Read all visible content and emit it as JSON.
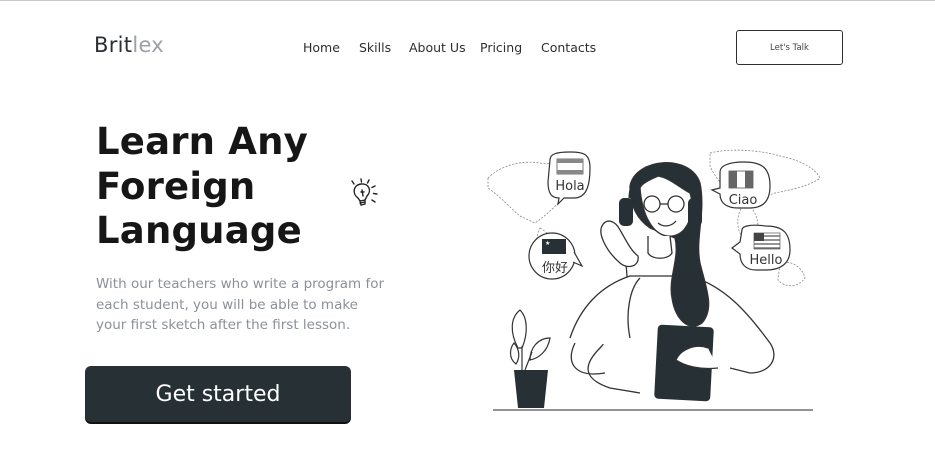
{
  "brand": {
    "part1": "Brit",
    "part2": "lex"
  },
  "nav": {
    "items": [
      {
        "label": "Home"
      },
      {
        "label": "Skills"
      },
      {
        "label": "About Us"
      },
      {
        "label": "Pricing"
      },
      {
        "label": "Contacts"
      }
    ]
  },
  "header": {
    "cta_label": "Let's Talk"
  },
  "hero": {
    "title_lines": [
      "Learn Any",
      "Foreign",
      "Language"
    ],
    "description_lines": [
      "With our teachers who write a program for",
      "each student, you will be able to make",
      "your first sketch after the first lesson."
    ],
    "cta_label": "Get started"
  },
  "illustration": {
    "bubbles": [
      {
        "text": "Hola"
      },
      {
        "text": "Ciao"
      },
      {
        "text": "你好"
      },
      {
        "text": "Hello"
      }
    ]
  },
  "colors": {
    "primary_dark": "#263035",
    "muted_text": "#8a9199",
    "logo_light": "#9aa0a6"
  },
  "icons": {
    "bulb": "lightbulb-icon"
  }
}
